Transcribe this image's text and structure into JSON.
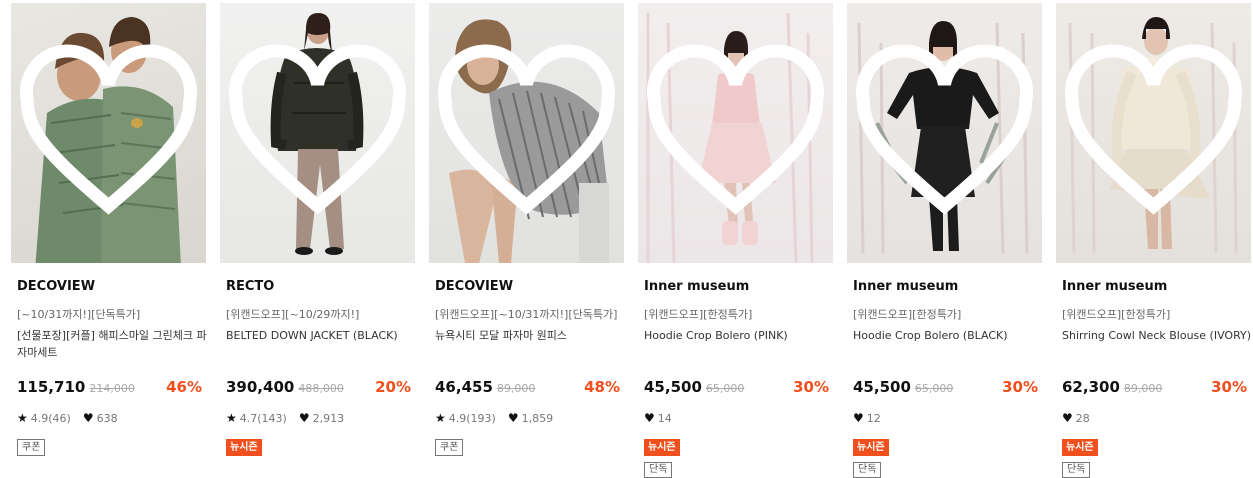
{
  "products": [
    {
      "brand": "DECOVIEW",
      "tag": "[~10/31까지!][단독특가]",
      "name": "[선물포장][커플] 해피스마일 그린체크 파자마세트",
      "price": "115,710",
      "original": "214,000",
      "discount": "46%",
      "rating": "4.9(46)",
      "likes": "638",
      "badges": [
        "쿠폰"
      ],
      "image": "couple-pajama-photo"
    },
    {
      "brand": "RECTO",
      "tag": "[위캔드오프][~10/29까지!]",
      "name": "BELTED DOWN JACKET (BLACK)",
      "price": "390,400",
      "original": "488,000",
      "discount": "20%",
      "rating": "4.7(143)",
      "likes": "2,913",
      "badges": [
        "뉴시즌"
      ],
      "image": "down-jacket-photo"
    },
    {
      "brand": "DECOVIEW",
      "tag": "[위캔드오프][~10/31까지!][단독특가]",
      "name": "뉴욕시티 모달 파자마 원피스",
      "price": "46,455",
      "original": "89,000",
      "discount": "48%",
      "rating": "4.9(193)",
      "likes": "1,859",
      "badges": [
        "쿠폰"
      ],
      "image": "stripe-pajama-dress-photo"
    },
    {
      "brand": "Inner museum",
      "tag": "[위캔드오프][한정특가]",
      "name": "Hoodie Crop Bolero (PINK)",
      "price": "45,500",
      "original": "65,000",
      "discount": "30%",
      "rating": "",
      "likes": "14",
      "badges": [
        "뉴시즌",
        "단독"
      ],
      "image": "pink-bolero-photo"
    },
    {
      "brand": "Inner museum",
      "tag": "[위캔드오프][한정특가]",
      "name": "Hoodie Crop Bolero (BLACK)",
      "price": "45,500",
      "original": "65,000",
      "discount": "30%",
      "rating": "",
      "likes": "12",
      "badges": [
        "뉴시즌",
        "단독"
      ],
      "image": "black-bolero-photo"
    },
    {
      "brand": "Inner museum",
      "tag": "[위캔드오프][한정특가]",
      "name": "Shirring Cowl Neck Blouse (IVORY)",
      "price": "62,300",
      "original": "89,000",
      "discount": "30%",
      "rating": "",
      "likes": "28",
      "badges": [
        "뉴시즌",
        "단독"
      ],
      "image": "ivory-blouse-photo"
    }
  ],
  "colors": {
    "accent": "#f14f1e",
    "badge_new": "#f0501e",
    "text": "#111111",
    "muted": "#777777"
  },
  "icons": {
    "wishlist": "heart-outline-icon",
    "star": "star-icon",
    "like": "heart-filled-icon"
  }
}
